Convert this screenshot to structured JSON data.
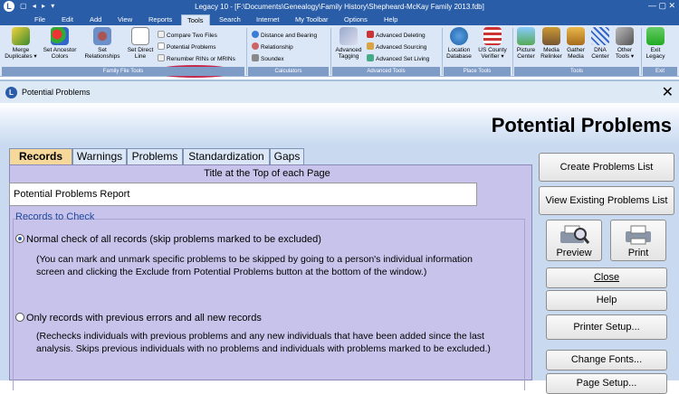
{
  "titlebar": {
    "qat": "▢ ◂ ▸ ▾",
    "title": "Legacy 10 - [F:\\Documents\\Genealogy\\Family History\\Shepheard-McKay Family 2013.fdb]",
    "controls": "—  ▢  ✕",
    "logo": "L"
  },
  "menu": [
    "File",
    "Edit",
    "Add",
    "View",
    "Reports",
    "Tools",
    "Search",
    "Internet",
    "My Toolbar",
    "Options",
    "Help"
  ],
  "ribbon": {
    "merge": "Merge\nDuplicates ▾",
    "set_ancestor": "Set Ancestor\nColors",
    "set_relationships": "Set\nRelationships",
    "set_direct": "Set Direct\nLine",
    "compare": "Compare Two Files",
    "potential": "Potential Problems",
    "renumber": "Renumber RINs or MRINs",
    "distance": "Distance and Bearing",
    "relationship": "Relationship",
    "soundex": "Soundex",
    "adv_tagging": "Advanced\nTagging",
    "adv_deleting": "Advanced Deleting",
    "adv_sourcing": "Advanced Sourcing",
    "adv_set_living": "Advanced Set Living",
    "location_db": "Location\nDatabase",
    "us_county": "US County\nVerifier ▾",
    "picture_center": "Picture\nCenter",
    "media_relinker": "Media\nRelinker",
    "gather_media": "Gather\nMedia",
    "dna_center": "DNA\nCenter",
    "other_tools": "Other\nTools ▾",
    "exit_legacy": "Exit\nLegacy",
    "groups": {
      "family": "Family File Tools",
      "calc": "Calculators",
      "advanced": "Advanced Tools",
      "place": "Place Tools",
      "tools": "Tools",
      "exit": "Exit"
    }
  },
  "dialog": {
    "window_title": "Potential Problems",
    "heading": "Potential Problems",
    "logo": "L",
    "close": "✕",
    "tabs": [
      "Records",
      "Warnings",
      "Problems",
      "Standardization",
      "Gaps"
    ],
    "title_label": "Title at the Top of each Page",
    "title_value": "Potential Problems Report",
    "records_to_check": "Records to Check",
    "option1": "Normal check of all records (skip problems marked to be excluded)",
    "option1_desc": "(You can mark and unmark specific problems to be skipped by going to a person's individual information screen and clicking the Exclude from Potential Problems button at the bottom of the window.)",
    "option2": "Only records with previous errors and all new records",
    "option2_desc": "(Rechecks individuals with previous problems and any new individuals that have been added since the last analysis.  Skips previous individuals with no problems and individuals with problems marked to be excluded.)",
    "buttons": {
      "create": "Create Problems List",
      "view": "View Existing Problems List",
      "preview": "Preview",
      "print": "Print",
      "close": "Close",
      "help": "Help",
      "printer_setup": "Printer Setup...",
      "change_fonts": "Change Fonts...",
      "page_setup": "Page Setup..."
    }
  }
}
